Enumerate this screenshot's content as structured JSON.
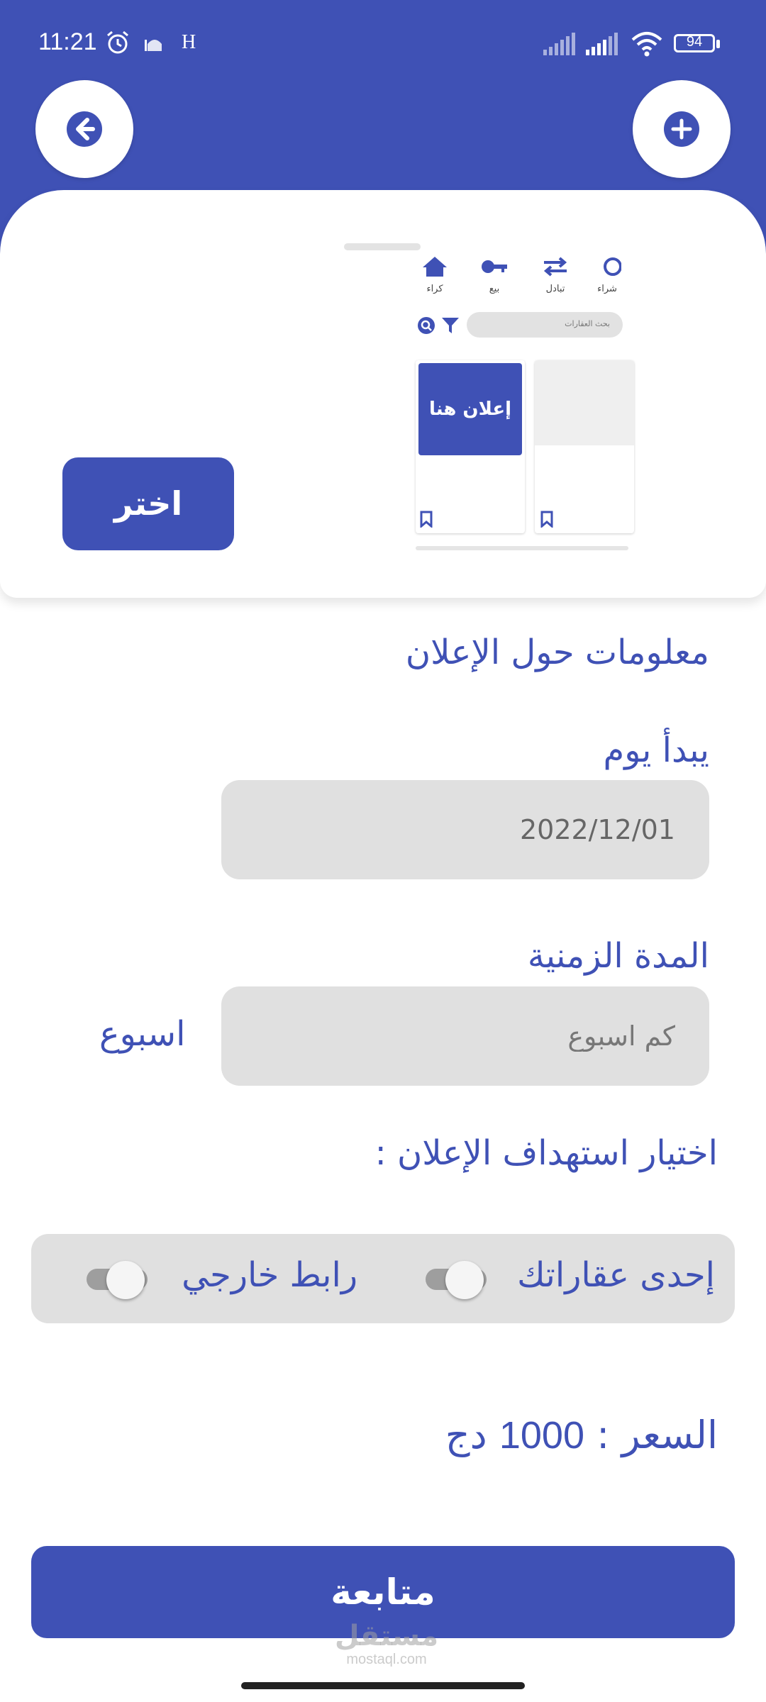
{
  "status_bar": {
    "time": "11:21",
    "network_letter": "H",
    "battery": "94"
  },
  "header": {
    "back_icon": "arrow-left-circle-icon",
    "add_icon": "plus-circle-icon"
  },
  "preview": {
    "nav": [
      {
        "label": "كراء",
        "icon": "home-icon"
      },
      {
        "label": "بيع",
        "icon": "key-icon"
      },
      {
        "label": "تبادل",
        "icon": "swap-icon"
      },
      {
        "label": "شراء",
        "icon": "cart-icon"
      }
    ],
    "search_placeholder": "بحث العقارات",
    "ad_text": "إعلان هنا"
  },
  "choose_button": "اختر",
  "section_title": "معلومات حول الإعلان",
  "start_day": {
    "label": "يبدأ يوم",
    "value": "2022/12/01"
  },
  "duration": {
    "label": "المدة الزمنية",
    "placeholder": "كم اسبوع",
    "unit": "اسبوع"
  },
  "targeting": {
    "label": "اختيار استهداف الإعلان :",
    "options": [
      {
        "label": "إحدى عقاراتك",
        "enabled": false
      },
      {
        "label": "رابط خارجي",
        "enabled": false
      }
    ]
  },
  "price": {
    "label": "السعر :",
    "amount": "1000",
    "currency": "دج"
  },
  "continue_button": "متابعة",
  "watermark": {
    "arabic": "مستقل",
    "latin": "mostaql.com"
  },
  "colors": {
    "primary": "#3f51b5",
    "field_bg": "#e0e0e0"
  }
}
